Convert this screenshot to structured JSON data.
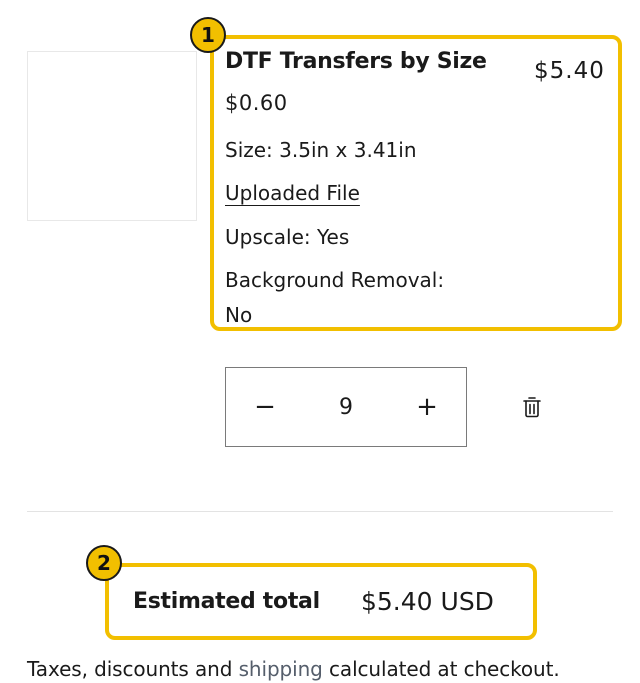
{
  "annotations": {
    "badge_1": "1",
    "badge_2": "2"
  },
  "colors": {
    "highlight": "#f2bf00",
    "text": "#1a1a1a",
    "link": "#555e6b"
  },
  "item": {
    "title": "DTF Transfers by Size",
    "line_price": "$5.40",
    "unit_price": "$0.60",
    "size": "Size: 3.5in x 3.41in",
    "uploaded_file": "Uploaded File",
    "upscale": "Upscale: Yes",
    "background_removal_label": "Background Removal:",
    "background_removal_value": "No"
  },
  "quantity": {
    "minus": "−",
    "value": "9",
    "plus": "+",
    "remove_icon": "trash-icon"
  },
  "summary": {
    "label": "Estimated total",
    "value": "$5.40 USD",
    "taxes_before": "Taxes, discounts and ",
    "taxes_link": "shipping",
    "taxes_after": " calculated at checkout."
  }
}
